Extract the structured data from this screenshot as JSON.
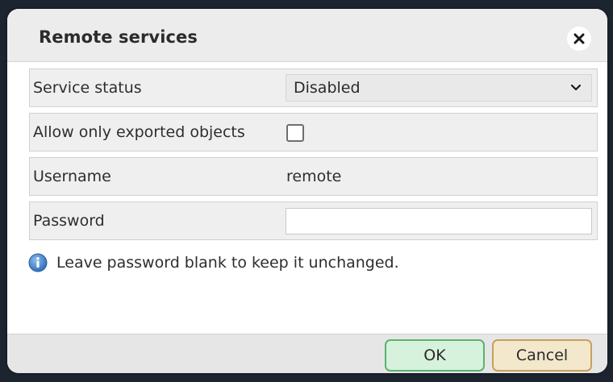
{
  "dialog": {
    "title": "Remote services",
    "close_icon": "close-icon"
  },
  "form": {
    "service_status": {
      "label": "Service status",
      "selected": "Disabled",
      "icon": "chevron-down-icon"
    },
    "exported_only": {
      "label": "Allow only exported objects",
      "checked": false
    },
    "username": {
      "label": "Username",
      "value": "remote"
    },
    "password": {
      "label": "Password",
      "value": ""
    }
  },
  "info": {
    "icon": "info-icon",
    "text": "Leave password blank to keep it unchanged."
  },
  "buttons": {
    "ok_label": "OK",
    "cancel_label": "Cancel"
  },
  "colors": {
    "ok_border": "#5bb36e",
    "ok_bg": "#d6f1dc",
    "cancel_border": "#c5a25b",
    "cancel_bg": "#f3e7cc",
    "info_icon": "#3d7fc9"
  }
}
